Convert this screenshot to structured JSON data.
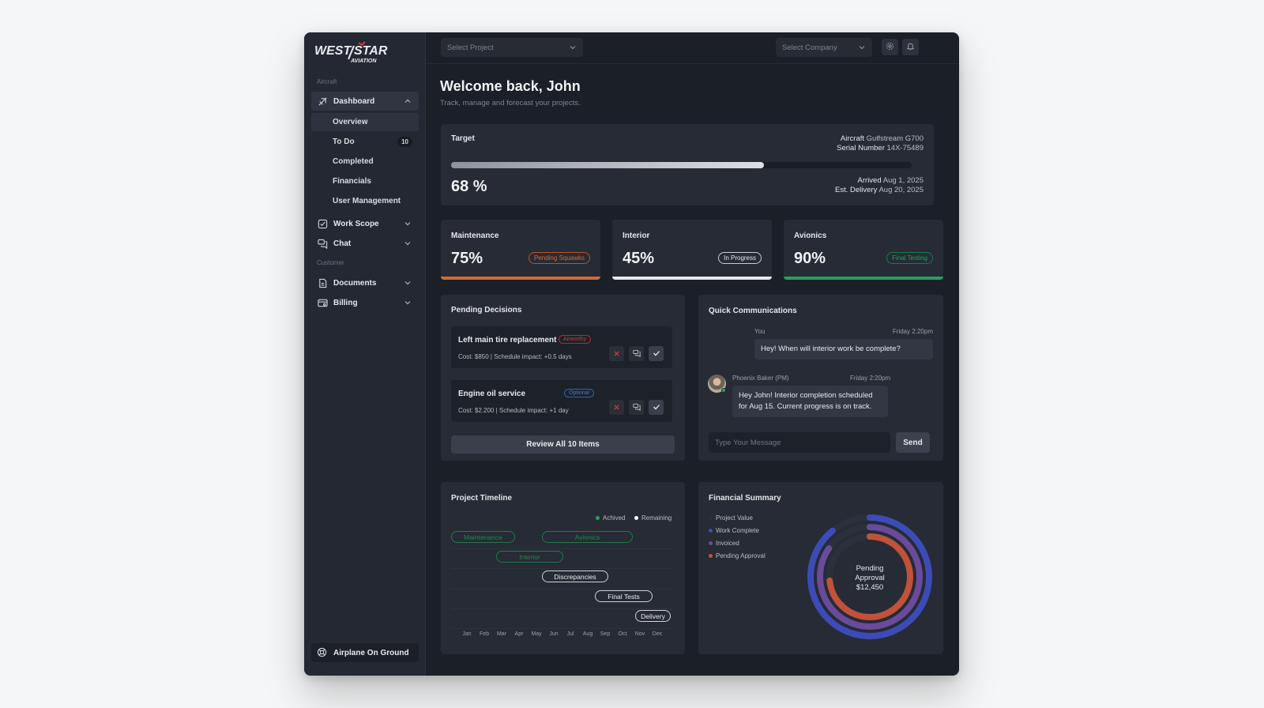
{
  "brand": {
    "logo_text_top": "WEST STAR",
    "logo_text_bottom": "AVIATION"
  },
  "sidebar": {
    "section_aircraft": "Aircraft",
    "dashboard": {
      "label": "Dashboard",
      "icon": "plane-icon"
    },
    "sub_items": [
      {
        "label": "Overview"
      },
      {
        "label": "To Do",
        "badge": "10"
      },
      {
        "label": "Completed"
      },
      {
        "label": "Financials"
      },
      {
        "label": "User Management"
      }
    ],
    "work_scope": {
      "label": "Work Scope"
    },
    "chat": {
      "label": "Chat"
    },
    "section_customer": "Customer",
    "documents": {
      "label": "Documents"
    },
    "billing": {
      "label": "Billing"
    },
    "aog": {
      "label": "Airplane On Ground"
    }
  },
  "topbar": {
    "project_placeholder": "Select Project",
    "company_placeholder": "Select Company"
  },
  "welcome": {
    "title": "Welcome back, John",
    "subtitle": "Track, manage and forecast your projects."
  },
  "target": {
    "label": "Target",
    "percent": 68,
    "percent_label": "68 %",
    "aircraft_label": "Aircraft",
    "aircraft_value": "Gulfstream G700",
    "serial_label": "Serial Number",
    "serial_value": "14X-75489",
    "arrived_label": "Arrived",
    "arrived_value": "Aug 1, 2025",
    "delivery_label": "Est. Delivery",
    "delivery_value": "Aug 20, 2025"
  },
  "stats": [
    {
      "label": "Maintenance",
      "value": "75%",
      "status": "Pending Squawks",
      "color": "#e0662a"
    },
    {
      "label": "Interior",
      "value": "45%",
      "status": "In Progress",
      "color": "#e6e8ec"
    },
    {
      "label": "Avionics",
      "value": "90%",
      "status": "Final Testing",
      "color": "#1fa35c"
    }
  ],
  "decisions": {
    "title": "Pending Decisions",
    "items": [
      {
        "title": "Left main tire replacement",
        "tag": "Airworthy",
        "meta": "Cost: $850 | Schedule impact: +0.5 days"
      },
      {
        "title": "Engine oil service",
        "tag": "Optional",
        "meta": "Cost: $2.200 | Schedule impact: +1 day"
      }
    ],
    "review_label": "Review All 10 Items"
  },
  "comms": {
    "title": "Quick Communications",
    "messages": [
      {
        "sender": "You",
        "time": "Friday 2:20pm",
        "text": "Hey! When will interior work be complete?"
      },
      {
        "sender": "Phoenix Baker (PM)",
        "time": "Friday 2:20pm",
        "text_line1": "Hey John! Interior completion scheduled",
        "text_line2": "for Aug 15. Current progress is on track."
      }
    ],
    "input_placeholder": "Type Your Message",
    "send_label": "Send"
  },
  "timeline": {
    "title": "Project Timeline",
    "legend": [
      {
        "label": "Achived",
        "color": "#1fa35c"
      },
      {
        "label": "Remaining",
        "color": "#ffffff"
      }
    ],
    "tasks": [
      {
        "label": "Maintenance",
        "status": "achieved"
      },
      {
        "label": "Avionics",
        "status": "achieved"
      },
      {
        "label": "Interior",
        "status": "achieved"
      },
      {
        "label": "Discrepancies",
        "status": "remaining"
      },
      {
        "label": "Final Tests",
        "status": "remaining"
      },
      {
        "label": "Delivery",
        "status": "remaining"
      }
    ],
    "months": [
      "Jan",
      "Feb",
      "Mar",
      "Apr",
      "May",
      "Jun",
      "Jul",
      "Aug",
      "Sep",
      "Oct",
      "Nov",
      "Dec"
    ]
  },
  "financial": {
    "title": "Financial Summary",
    "legend": [
      {
        "label": "Project Value",
        "color": "#2b313c"
      },
      {
        "label": "Work Complete",
        "color": "#3d4bb8"
      },
      {
        "label": "Invoiced",
        "color": "#6a4a9a"
      },
      {
        "label": "Pending Approval",
        "color": "#c2513a"
      }
    ],
    "center_line1": "Pending",
    "center_line2": "Approval",
    "center_value": "$12,450"
  }
}
